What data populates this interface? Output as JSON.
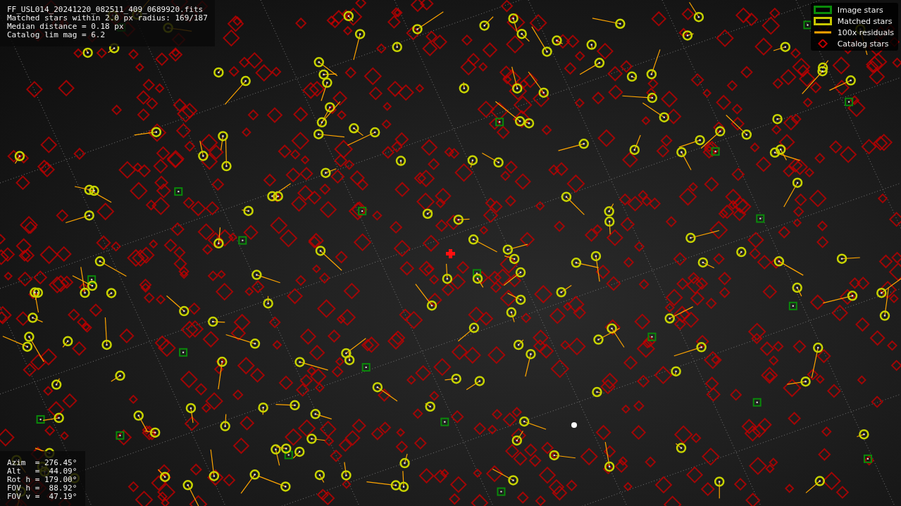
{
  "info_panel": {
    "lines": [
      "FF_USL014_20241220_082511_409_0689920.fits",
      "Matched stars within 2.0 px radius: 169/187",
      "Median distance = 0.18 px",
      "Catalog lim mag = 6.2"
    ]
  },
  "legend": [
    {
      "kind": "box",
      "color": "#0a8a0a",
      "label": "Image stars"
    },
    {
      "kind": "box",
      "color": "#c8c800",
      "label": "Matched stars"
    },
    {
      "kind": "line",
      "color": "#ffa500",
      "label": "100x residuals"
    },
    {
      "kind": "diamond",
      "color": "#c00000",
      "label": "Catalog stars"
    }
  ],
  "pointing_panel": {
    "lines": [
      "Azim  = 276.45°",
      "Alt   =  44.09°",
      "Rot h = 179.00°",
      "FOV h =  88.92°",
      "FOV v =  47.19°"
    ]
  }
}
